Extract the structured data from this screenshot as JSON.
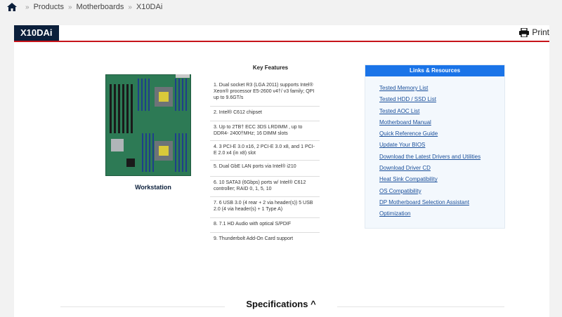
{
  "breadcrumb": {
    "items": [
      "Products",
      "Motherboards",
      "X10DAi"
    ]
  },
  "header": {
    "title": "X10DAi",
    "print_label": "Print"
  },
  "product": {
    "caption": "Workstation"
  },
  "key_features": {
    "title": "Key Features",
    "items": [
      "1. Dual socket R3 (LGA 2011) supports Intel® Xeon® processor E5-2600 v4†/ v3 family; QPI up to 9.6GT/s",
      "2. Intel® C612 chipset",
      "3. Up to 2TB† ECC 3DS LRDIMM , up to DDR4- 2400†MHz; 16 DIMM slots",
      "4. 3 PCI-E 3.0 x16, 2 PCI-E 3.0 x8, and 1 PCI-E 2.0 x4 (in x8) slot",
      "5. Dual GbE LAN ports via Intel® i210",
      "6. 10 SATA3 (6Gbps) ports w/ Intel® C612 controller; RAID 0, 1, 5, 10",
      "7. 6 USB 3.0 (4 rear + 2 via header(s)) 5 USB 2.0 (4 via header(s) + 1 Type A)",
      "8. 7.1 HD Audio with optical S/PDIF",
      "9. Thunderbolt Add-On Card support"
    ]
  },
  "links": {
    "title": "Links & Resources",
    "items": [
      "Tested Memory List",
      "Tested HDD / SSD List",
      "Tested AOC List",
      "Motherboard Manual",
      "Quick Reference Guide",
      "Update Your BIOS",
      "Download the Latest Drivers and Utilities",
      "Download Driver CD",
      "Heat Sink Compatibility",
      "OS Compatibility",
      "DP Motherboard Selection Assistant",
      "Optimization"
    ]
  },
  "specs": {
    "label": "Specifications ^"
  },
  "colors": {
    "navy": "#0b1f3b",
    "red": "#c7141a",
    "blue": "#1a74e8",
    "link": "#1a4f9a"
  }
}
